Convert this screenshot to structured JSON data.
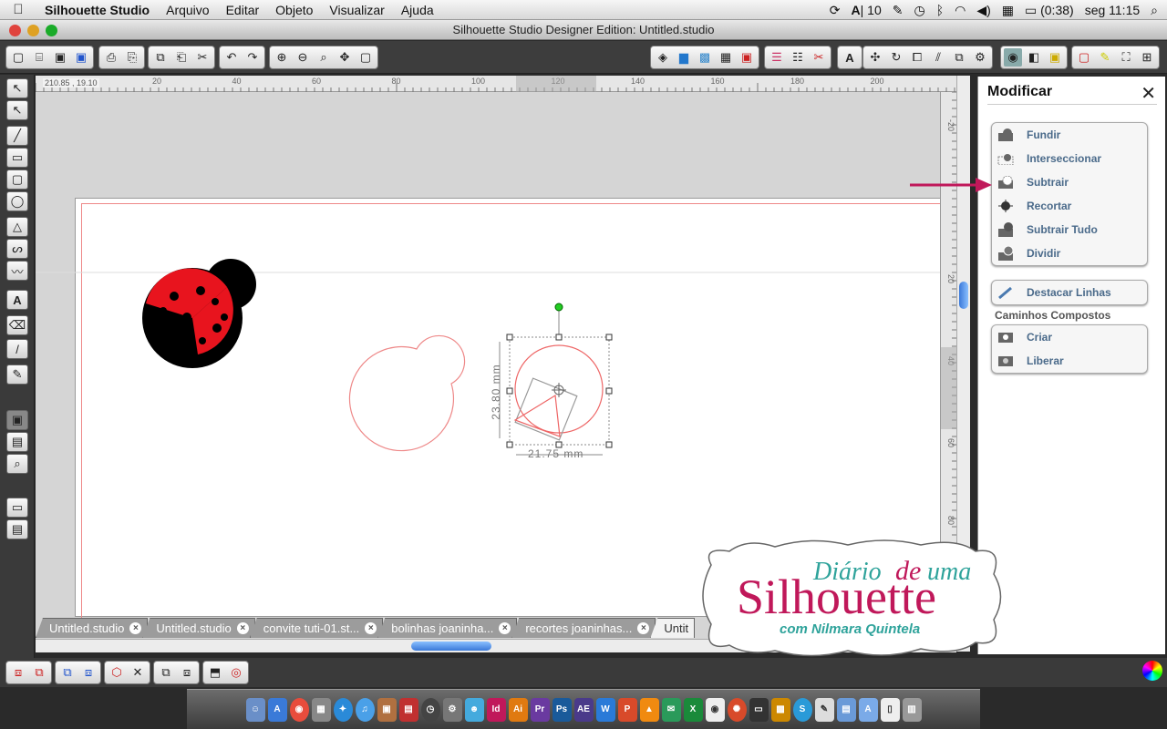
{
  "menubar": {
    "apple": "",
    "app_name": "Silhouette Studio",
    "items": [
      "Arquivo",
      "Editar",
      "Objeto",
      "Visualizar",
      "Ajuda"
    ],
    "status": {
      "adobe": "10",
      "battery": "(0:38)",
      "clock": "seg 11:15"
    }
  },
  "window": {
    "title": "Silhouette Studio Designer Edition: Untitled.studio"
  },
  "ruler": {
    "coords": "210.85 , 19.10",
    "h_ticks": [
      "20",
      "40",
      "60",
      "80",
      "100",
      "120",
      "140",
      "160",
      "180",
      "200"
    ],
    "v_ticks": [
      "-20",
      "20",
      "40",
      "60",
      "80"
    ]
  },
  "selection": {
    "height_label": "23.80 mm",
    "width_label": "21.75 mm"
  },
  "tabs": [
    {
      "label": "Untitled.studio"
    },
    {
      "label": "Untitled.studio"
    },
    {
      "label": "convite tuti-01.st..."
    },
    {
      "label": "bolinhas joaninha..."
    },
    {
      "label": "recortes joaninhas..."
    },
    {
      "label": "Untit"
    }
  ],
  "panel": {
    "title": "Modificar",
    "close": "✕",
    "modify_items": [
      {
        "label": "Fundir",
        "icon": "weld-icon"
      },
      {
        "label": "Interseccionar",
        "icon": "intersect-icon"
      },
      {
        "label": "Subtrair",
        "icon": "subtract-icon"
      },
      {
        "label": "Recortar",
        "icon": "crop-icon"
      },
      {
        "label": "Subtrair Tudo",
        "icon": "subtract-all-icon"
      },
      {
        "label": "Dividir",
        "icon": "divide-icon"
      }
    ],
    "detach_label": "Destacar Linhas",
    "compound_title": "Caminhos Compostos",
    "compound_items": [
      {
        "label": "Criar",
        "icon": "make-compound-icon"
      },
      {
        "label": "Liberar",
        "icon": "release-compound-icon"
      }
    ]
  },
  "branding": {
    "line1": "Diário",
    "line1b": "de",
    "line1c": "uma",
    "line2": "Silhouette",
    "line3": "com Nilmara Quintela"
  },
  "dock_labels": [
    "Id",
    "Ai",
    "Pr",
    "Ps",
    "AE",
    "W"
  ],
  "colors": {
    "accent_pink": "#c0185a",
    "ladybug_red": "#e8141e",
    "handle_green": "#22cc22"
  }
}
